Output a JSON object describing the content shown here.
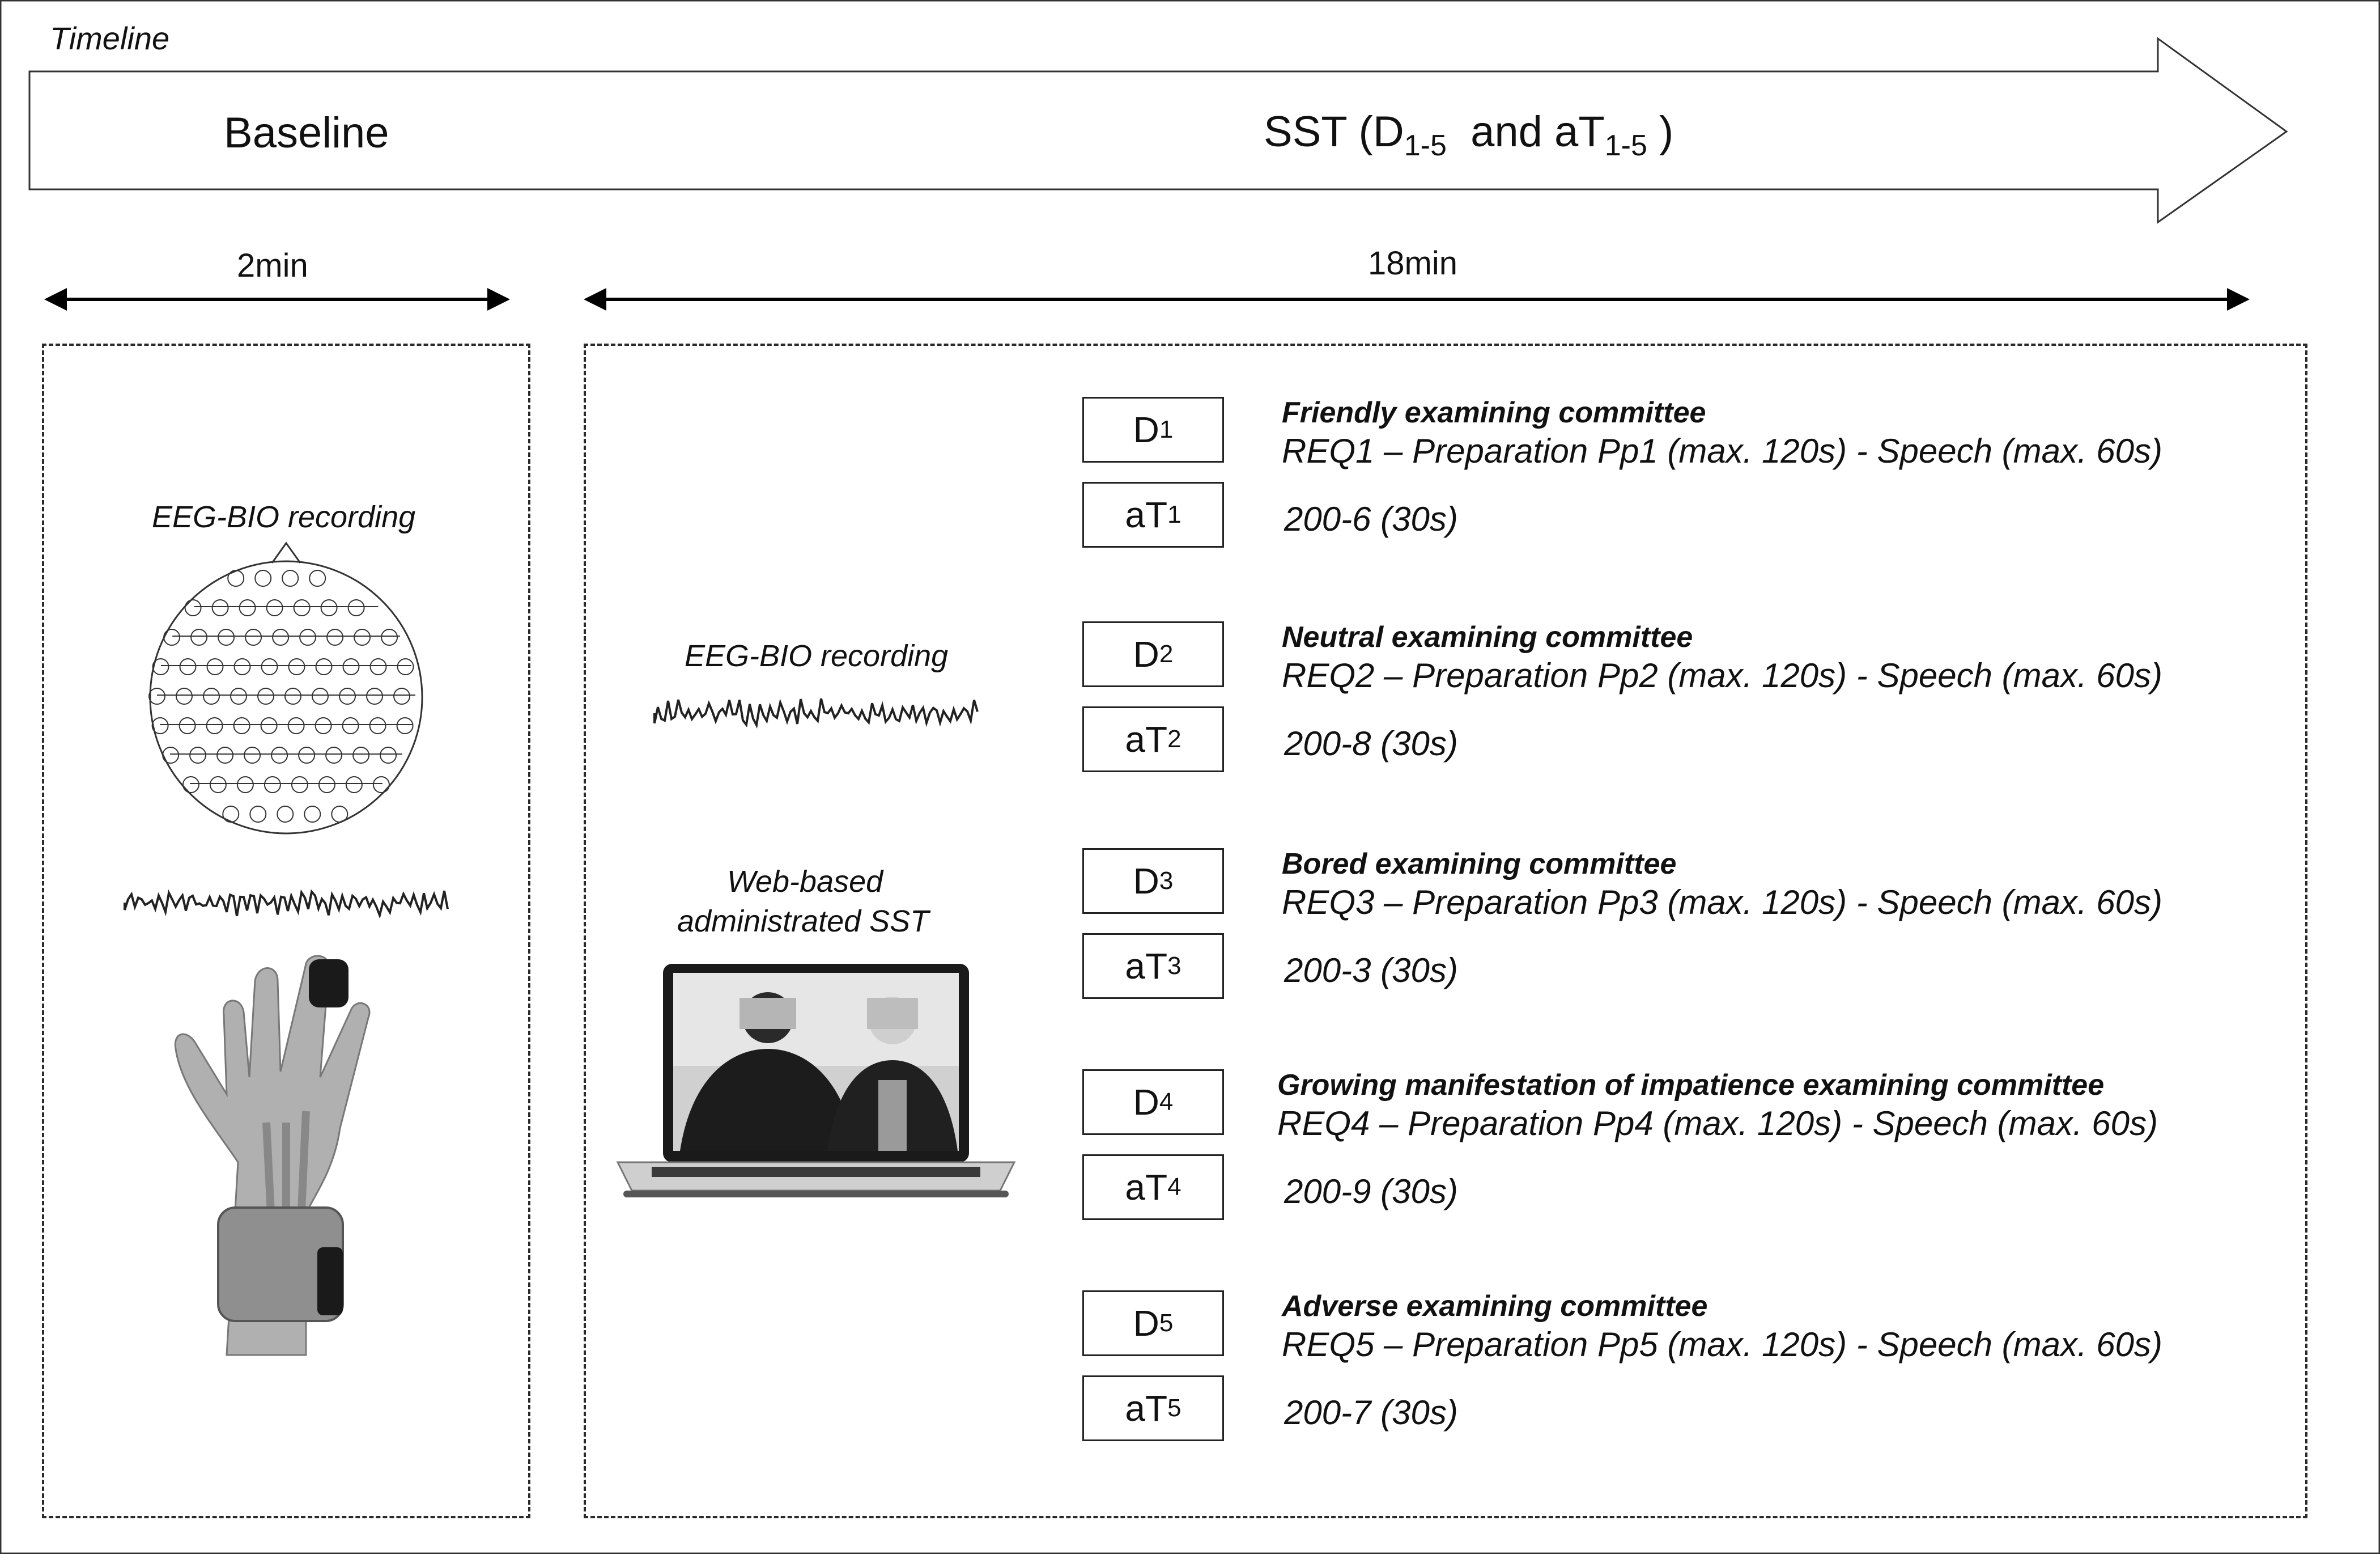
{
  "timeline": {
    "label": "Timeline",
    "baseline_label": "Baseline",
    "sst_label": {
      "prefix": "SST (D",
      "sub1": "1-5",
      "mid": "  and aT",
      "sub2": "1-5",
      "suffix": " )"
    }
  },
  "durations": {
    "baseline": "2min",
    "sst": "18min"
  },
  "baseline_panel": {
    "eeg_label": "EEG-BIO recording"
  },
  "sst_panel": {
    "eeg_label": "EEG-BIO recording",
    "web_label_line1": "Web-based",
    "web_label_line2": "administrated SST"
  },
  "phases": [
    {
      "d_base": "D",
      "d_sub": "1",
      "at_base": "aT",
      "at_sub": "1",
      "committee": "Friendly examining committee",
      "task": "REQ1 – Preparation Pp1 (max. 120s) - Speech (max. 60s)",
      "arith": "200-6 (30s)"
    },
    {
      "d_base": "D",
      "d_sub": "2",
      "at_base": "aT",
      "at_sub": "2",
      "committee": "Neutral examining committee",
      "task": "REQ2 – Preparation Pp2 (max. 120s) - Speech (max. 60s)",
      "arith": "200-8 (30s)"
    },
    {
      "d_base": "D",
      "d_sub": "3",
      "at_base": "aT",
      "at_sub": "3",
      "committee": "Bored examining committee",
      "task": "REQ3 – Preparation Pp3 (max. 120s) - Speech (max. 60s)",
      "arith": "200-3 (30s)"
    },
    {
      "d_base": "D",
      "d_sub": "4",
      "at_base": "aT",
      "at_sub": "4",
      "committee": "Growing manifestation of impatience examining committee",
      "task": "REQ4 – Preparation Pp4 (max. 120s) - Speech (max. 60s)",
      "arith": "200-9 (30s)"
    },
    {
      "d_base": "D",
      "d_sub": "5",
      "at_base": "aT",
      "at_sub": "5",
      "committee": "Adverse examining committee",
      "task": "REQ5 – Preparation Pp5 (max. 120s) - Speech (max. 60s)",
      "arith": "200-7 (30s)"
    }
  ],
  "icons": {
    "eeg_cap": "eeg-electrode-map-icon",
    "signal": "eeg-signal-trace-icon",
    "hand": "hand-with-sensors-icon",
    "laptop": "laptop-video-call-icon"
  }
}
